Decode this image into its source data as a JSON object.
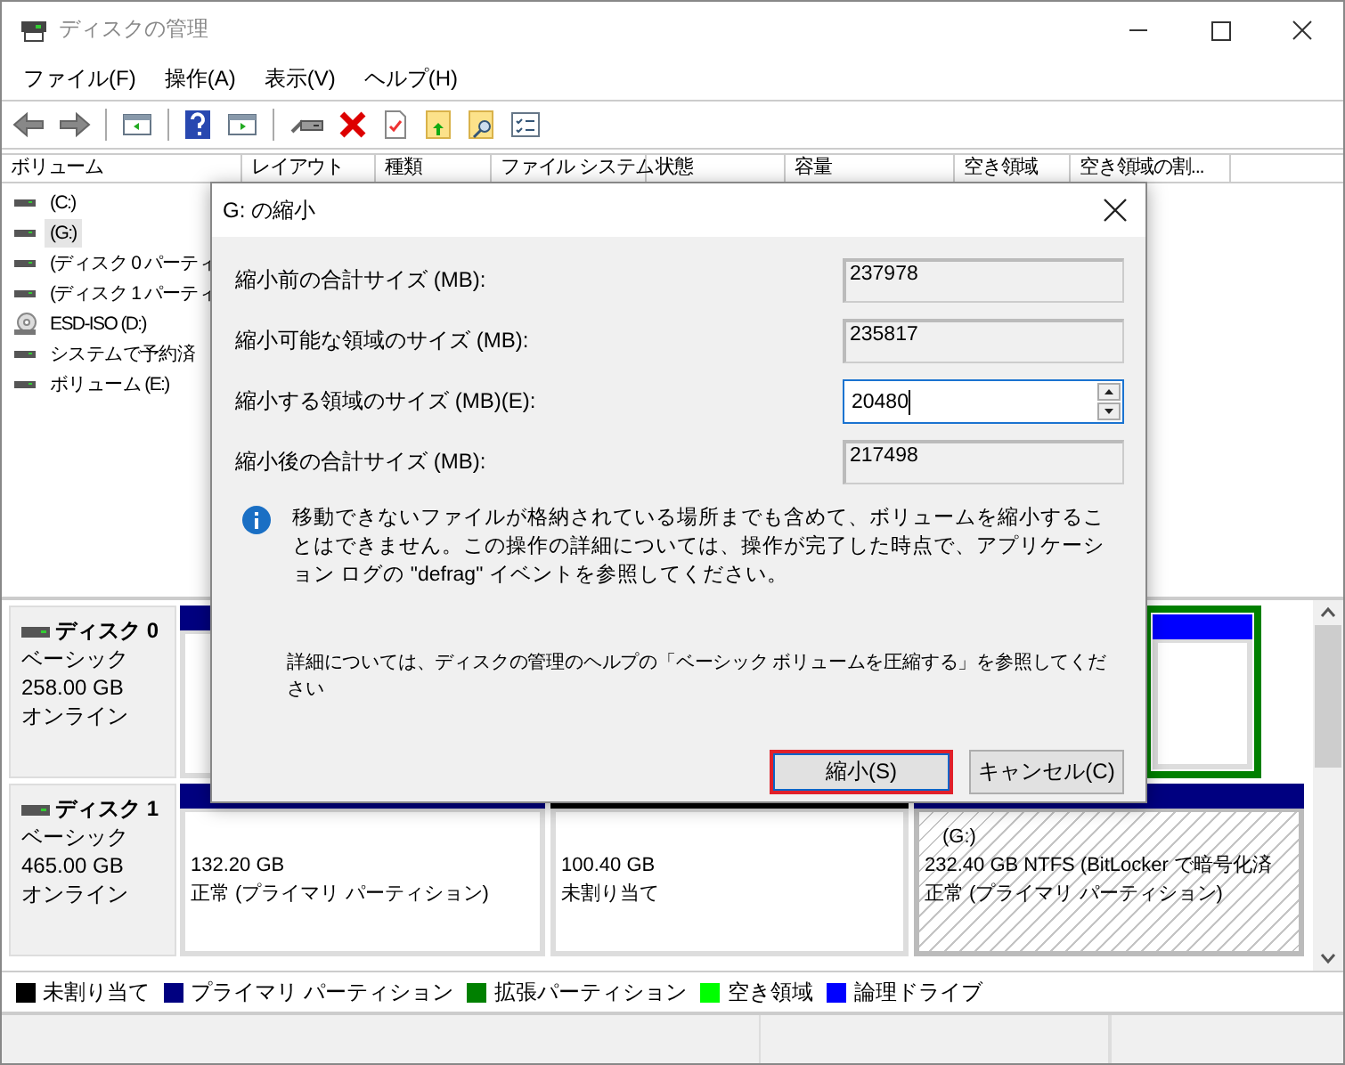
{
  "window": {
    "title": "ディスクの管理"
  },
  "menu": [
    "ファイル(F)",
    "操作(A)",
    "表示(V)",
    "ヘルプ(H)"
  ],
  "volume_list": {
    "columns": [
      "ボリューム",
      "レイアウト",
      "種類",
      "ファイル システム",
      "状態",
      "容量",
      "空き領域",
      "空き領域の割..."
    ],
    "rows": [
      {
        "name": "(C:)",
        "kind": "disk",
        "selected": false
      },
      {
        "name": "(G:)",
        "kind": "disk",
        "selected": true
      },
      {
        "name": "(ディスク 0 パーティ",
        "kind": "disk",
        "selected": false
      },
      {
        "name": "(ディスク 1 パーティ",
        "kind": "disk",
        "selected": false
      },
      {
        "name": "ESD-ISO (D:)",
        "kind": "cd",
        "selected": false
      },
      {
        "name": "システムで予約済",
        "kind": "disk",
        "selected": false
      },
      {
        "name": "ボリューム (E:)",
        "kind": "disk",
        "selected": false
      }
    ]
  },
  "disks": [
    {
      "name": "ディスク 0",
      "type": "ベーシック",
      "size": "258.00 GB",
      "status": "オンライン",
      "partitions": [
        {
          "kind": "primary"
        },
        {
          "kind": "extended",
          "children": [
            {
              "kind": "logical"
            }
          ]
        }
      ]
    },
    {
      "name": "ディスク 1",
      "type": "ベーシック",
      "size": "465.00 GB",
      "status": "オンライン",
      "partitions": [
        {
          "kind": "primary",
          "selected": false,
          "size": "132.20 GB",
          "status": "正常 (プライマリ パーティション)"
        },
        {
          "kind": "unallocated",
          "selected": false,
          "size": "100.40 GB",
          "status": "未割り当て"
        },
        {
          "kind": "primary",
          "selected": true,
          "label": "(G:)",
          "size": "232.40 GB NTFS (BitLocker で暗号化済",
          "status": "正常 (プライマリ パーティション)"
        }
      ]
    }
  ],
  "legend": [
    {
      "label": "未割り当て",
      "color": "#000000"
    },
    {
      "label": "プライマリ パーティション",
      "color": "#000080"
    },
    {
      "label": "拡張パーティション",
      "color": "#008000"
    },
    {
      "label": "空き領域",
      "color": "#00ff00"
    },
    {
      "label": "論理ドライブ",
      "color": "#0000ff"
    }
  ],
  "dialog": {
    "title": "G: の縮小",
    "fields": [
      {
        "label": "縮小前の合計サイズ (MB):",
        "value": "237978",
        "kind": "readonly"
      },
      {
        "label": "縮小可能な領域のサイズ (MB):",
        "value": "235817",
        "kind": "readonly"
      },
      {
        "label": "縮小する領域のサイズ (MB)(E):",
        "value": "20480",
        "kind": "spin"
      },
      {
        "label": "縮小後の合計サイズ (MB):",
        "value": "217498",
        "kind": "readonly"
      }
    ],
    "note": "移動できないファイルが格納されている場所までも含めて、ボリュームを縮小することはできません。この操作の詳細については、操作が完了した時点で、アプリケーション ログの \"defrag\" イベントを参照してください。",
    "help": "詳細については、ディスクの管理のヘルプの「ベーシック ボリュームを圧縮する」を参照してください",
    "buttons": [
      {
        "label": "縮小(S)",
        "highlighted": true
      },
      {
        "label": "キャンセル(C)",
        "highlighted": false
      }
    ]
  }
}
